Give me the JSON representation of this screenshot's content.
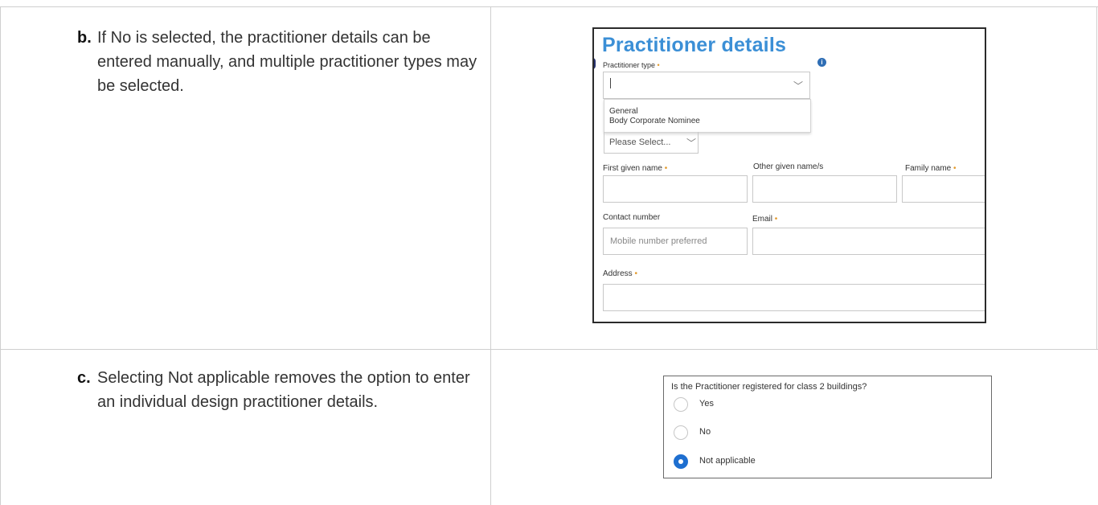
{
  "rows": [
    {
      "letter": "b.",
      "text": "If No is selected, the practitioner details can be entered manually, and multiple practitioner types may be selected."
    },
    {
      "letter": "c.",
      "text": "Selecting Not applicable removes the option to enter an individual design practitioner details."
    }
  ],
  "practitioner_form": {
    "title": "Practitioner details",
    "practitioner_type_label": "Practitioner type",
    "dropdown_options": [
      "General",
      "Body Corporate Nominee"
    ],
    "select_value": "Please Select...",
    "first_given_name_label": "First given name",
    "other_given_names_label": "Other given name/s",
    "family_name_label": "Family name",
    "contact_number_label": "Contact number",
    "contact_number_placeholder": "Mobile number preferred",
    "email_label": "Email",
    "address_label": "Address",
    "required_marker": "•",
    "info_icon": "i"
  },
  "class2_question": {
    "question": "Is the Practitioner registered for class 2 buildings?",
    "options": [
      {
        "label": "Yes",
        "selected": false
      },
      {
        "label": "No",
        "selected": false
      },
      {
        "label": "Not applicable",
        "selected": true
      }
    ]
  },
  "colors": {
    "title_blue": "#3b8fd6",
    "required_orange": "#e39a2c",
    "radio_selected": "#1e6fd0",
    "table_border": "#cfcfcf"
  }
}
